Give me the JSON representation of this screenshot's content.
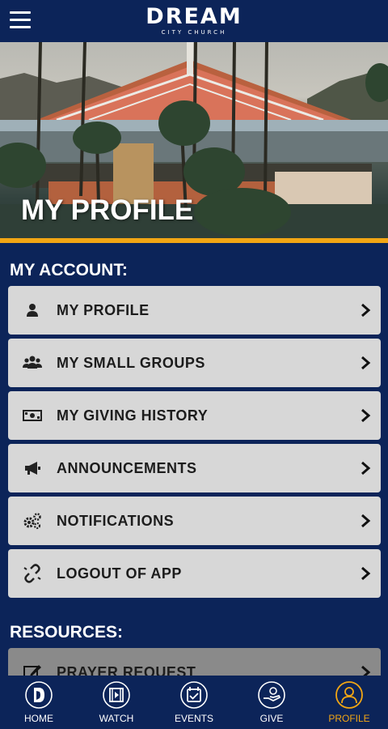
{
  "header": {
    "logo_main": "DREAM",
    "logo_sub": "CITY CHURCH",
    "menu_icon": "hamburger-icon"
  },
  "hero": {
    "title": "MY PROFILE",
    "accent_color": "#f2a614"
  },
  "account_section": {
    "title": "MY ACCOUNT:",
    "items": [
      {
        "label": "MY PROFILE",
        "icon": "user-icon"
      },
      {
        "label": "MY SMALL GROUPS",
        "icon": "users-icon"
      },
      {
        "label": "MY GIVING HISTORY",
        "icon": "money-icon"
      },
      {
        "label": "ANNOUNCEMENTS",
        "icon": "megaphone-icon"
      },
      {
        "label": "NOTIFICATIONS",
        "icon": "gears-icon"
      },
      {
        "label": "LOGOUT OF APP",
        "icon": "unlink-icon"
      }
    ]
  },
  "resources_section": {
    "title": "RESOURCES:",
    "items": [
      {
        "label": "PRAYER REQUEST",
        "icon": "edit-icon"
      }
    ]
  },
  "bottom_nav": {
    "items": [
      {
        "label": "HOME",
        "icon": "home-logo-icon"
      },
      {
        "label": "WATCH",
        "icon": "film-icon"
      },
      {
        "label": "EVENTS",
        "icon": "calendar-icon"
      },
      {
        "label": "GIVE",
        "icon": "give-hand-icon"
      },
      {
        "label": "PROFILE",
        "icon": "profile-icon"
      }
    ],
    "active": "PROFILE",
    "active_color": "#f2a614"
  },
  "colors": {
    "navy": "#0c2459",
    "item_bg": "#d7d7d7"
  }
}
